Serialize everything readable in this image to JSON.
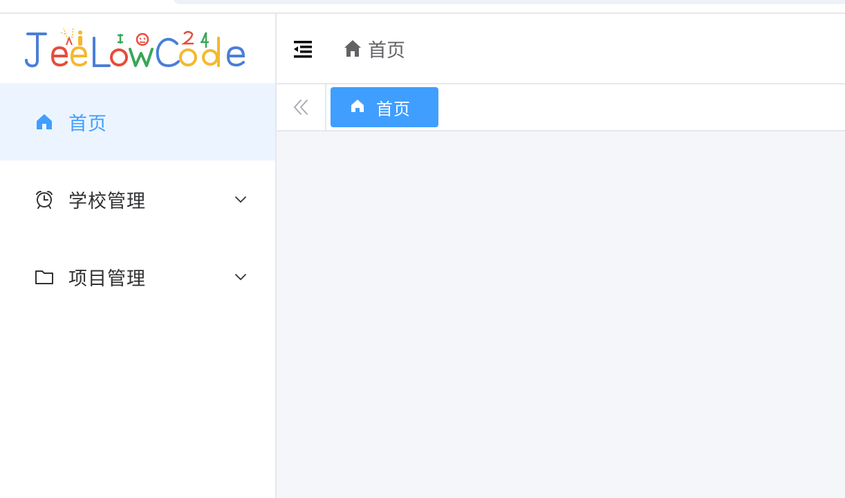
{
  "app": {
    "logo_text": "JeeLowCode",
    "logo_colors": {
      "J": "#4a7fd8",
      "e1": "#e74c3c",
      "e2": "#f5b82e",
      "L": "#4a7fd8",
      "o": "#e74c3c",
      "w": "#3aa757",
      "C": "#4a7fd8",
      "o2": "#f5b82e",
      "d": "#f5b82e",
      "e3": "#4a7fd8"
    }
  },
  "colors": {
    "primary": "#409eff",
    "active_bg": "#ecf5ff",
    "text": "#303133",
    "muted": "#606266",
    "content_bg": "#f5f6f9"
  },
  "sidebar": {
    "items": [
      {
        "label": "首页",
        "icon": "home-icon",
        "active": true
      },
      {
        "label": "学校管理",
        "icon": "alarm-clock-icon",
        "has_children": true
      },
      {
        "label": "项目管理",
        "icon": "folder-icon",
        "has_children": true
      }
    ]
  },
  "header": {
    "collapse_icon": "menu-fold-icon",
    "breadcrumb": [
      {
        "label": "首页",
        "icon": "home-icon"
      }
    ]
  },
  "tabs": {
    "scroll_left_icon": "double-chevron-left-icon",
    "items": [
      {
        "label": "首页",
        "icon": "home-icon",
        "active": true
      }
    ]
  }
}
